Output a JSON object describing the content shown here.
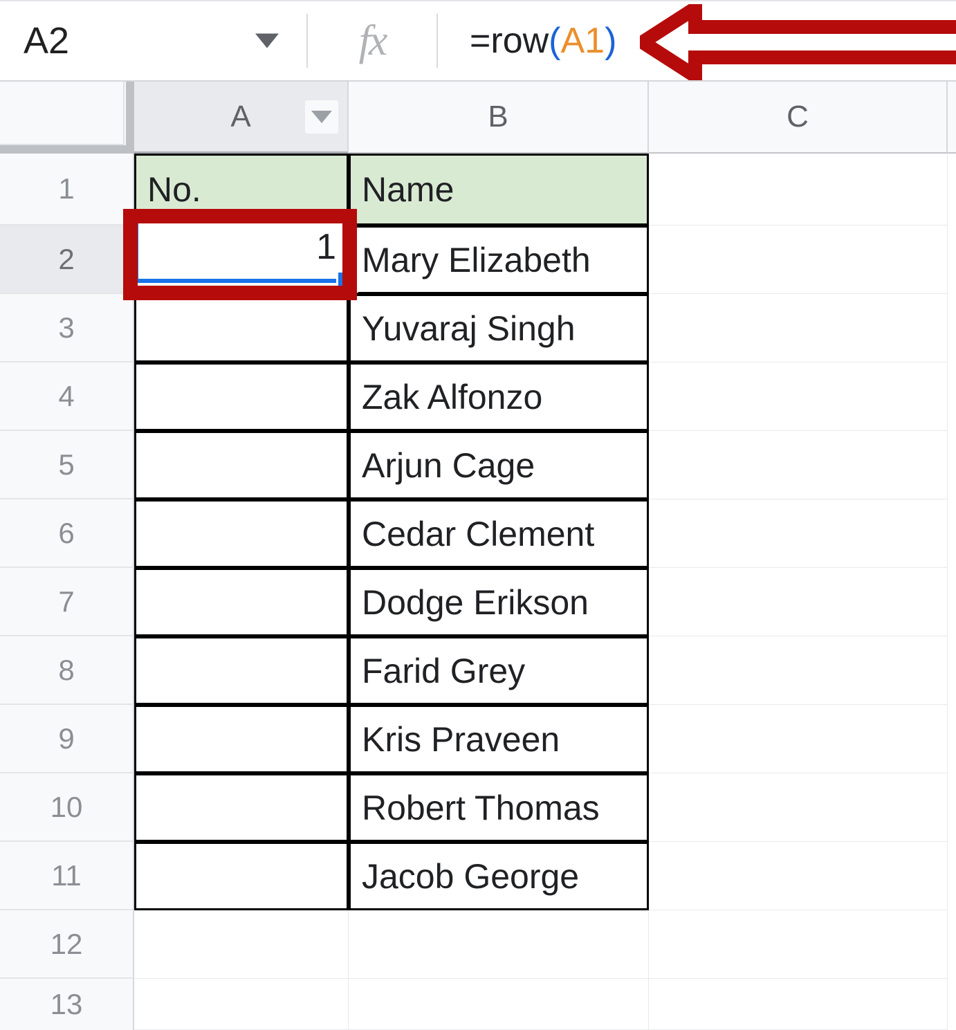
{
  "app": "google-sheets-grid",
  "formula_bar": {
    "name_box_value": "A2",
    "name_box_dropdown_icon": "chevron-down-icon",
    "fx_icon": "fx-icon",
    "fx_glyph": "fx",
    "formula": {
      "full": "=row(A1)",
      "tokens": {
        "equals": "=",
        "function": "row",
        "open_paren": "(",
        "reference": "A1",
        "close_paren": ")"
      }
    }
  },
  "annotations": {
    "arrow": {
      "icon": "left-arrow-annotation",
      "direction": "left",
      "color": "#B60B0B",
      "points_at": "formula-bar-formula"
    },
    "highlight_box": {
      "icon": "rectangle-highlight-annotation",
      "color": "#B60B0B",
      "targets": "cell-A2"
    }
  },
  "grid": {
    "columns": [
      {
        "label": "A",
        "selected": true,
        "has_dropdown": true,
        "dropdown_icon": "chevron-down-icon"
      },
      {
        "label": "B",
        "selected": false,
        "has_dropdown": false
      },
      {
        "label": "C",
        "selected": false,
        "has_dropdown": false
      }
    ],
    "row_numbers": [
      "1",
      "2",
      "3",
      "4",
      "5",
      "6",
      "7",
      "8",
      "9",
      "10",
      "11",
      "12",
      "13"
    ],
    "selected_row": "2",
    "selected_cell": "A2",
    "selected_cell_value": "1",
    "header_fill_color": "#D9EAD3",
    "selection_color": "#1A73E8",
    "table_headers": {
      "a": "No.",
      "b": "Name"
    },
    "rows": [
      {
        "row": "2",
        "no": "",
        "name": "Mary Elizabeth"
      },
      {
        "row": "3",
        "no": "",
        "name": "Yuvaraj Singh"
      },
      {
        "row": "4",
        "no": "",
        "name": "Zak Alfonzo"
      },
      {
        "row": "5",
        "no": "",
        "name": "Arjun Cage"
      },
      {
        "row": "6",
        "no": "",
        "name": "Cedar Clement"
      },
      {
        "row": "7",
        "no": "",
        "name": "Dodge Erikson"
      },
      {
        "row": "8",
        "no": "",
        "name": "Farid Grey"
      },
      {
        "row": "9",
        "no": "",
        "name": "Kris Praveen"
      },
      {
        "row": "10",
        "no": "",
        "name": "Robert Thomas"
      },
      {
        "row": "11",
        "no": "",
        "name": "Jacob George"
      }
    ],
    "empty_rows": [
      "12",
      "13"
    ]
  }
}
